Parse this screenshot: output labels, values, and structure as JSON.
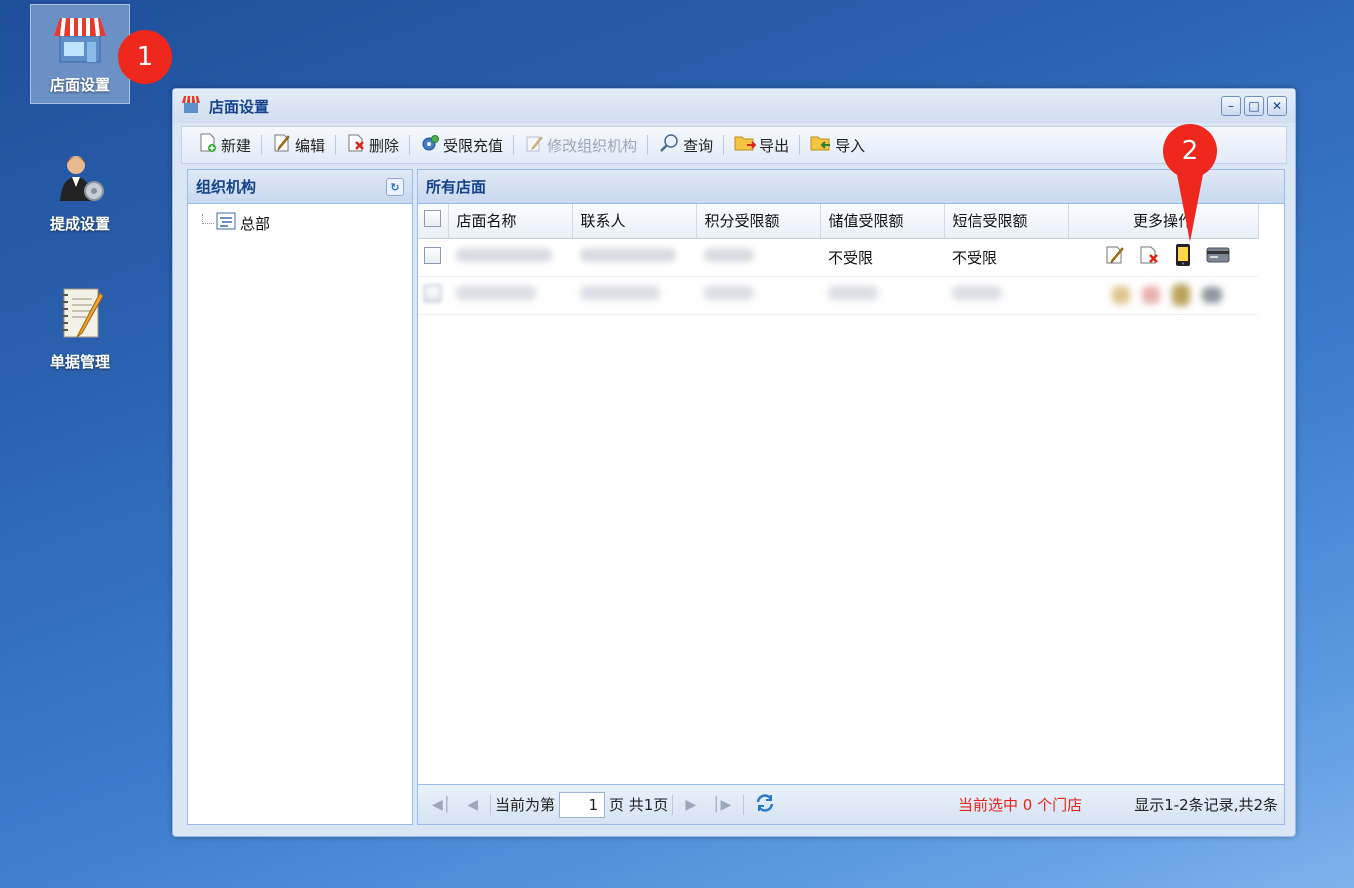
{
  "desktop": {
    "icons": [
      {
        "label": "店面设置"
      },
      {
        "label": "提成设置"
      },
      {
        "label": "单据管理"
      }
    ]
  },
  "badges": [
    "1",
    "2"
  ],
  "window": {
    "title": "店面设置",
    "toolbar": {
      "new": "新建",
      "edit": "编辑",
      "delete": "删除",
      "recharge": "受限充值",
      "modify_org": "修改组织机构",
      "query": "查询",
      "export": "导出",
      "import": "导入"
    },
    "left_panel": {
      "title": "组织机构",
      "tree_root": "总部"
    },
    "right_panel": {
      "title": "所有店面",
      "columns": [
        "店面名称",
        "联系人",
        "积分受限额",
        "储值受限额",
        "短信受限额",
        "更多操作"
      ],
      "rows": [
        {
          "stored_value_limit": "不受限",
          "sms_limit": "不受限"
        },
        {}
      ]
    },
    "pager": {
      "current_label": "当前为第",
      "page_value": "1",
      "page_total": "页 共1页",
      "selected_info": "当前选中 0 个门店",
      "records_info": "显示1-2条记录,共2条"
    }
  },
  "colors": {
    "badge": "#f0271d",
    "accent": "#15428b",
    "selected_text": "#e8231b"
  }
}
